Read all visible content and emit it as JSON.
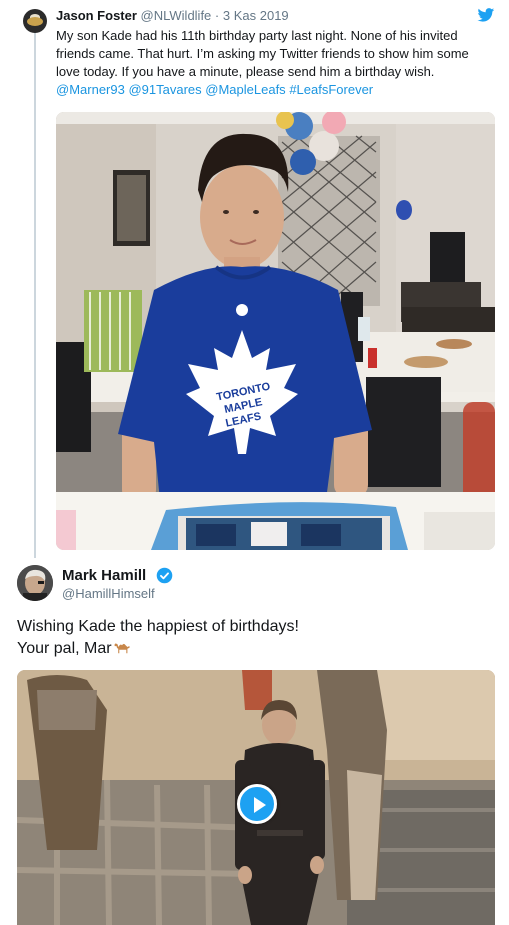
{
  "quoted_tweet": {
    "author_name": "Jason Foster",
    "author_handle": "@NLWildlife",
    "separator": "·",
    "date": "3 Kas 2019",
    "text_plain": "My son Kade had his 11th birthday party last night. None of his invited friends came. That hurt. I’m asking my Twitter friends to show him some love today. If you have a minute, please send him a birthday wish. ",
    "mentions": [
      "@Marner93",
      "@91Tavares",
      "@MapleLeafs",
      "#LeafsForever"
    ],
    "photo": {
      "shirt_text_line1": "TORONTO",
      "shirt_text_line2": "MAPLE",
      "shirt_text_line3": "LEAFS",
      "brand_color": "#1a3d9c"
    },
    "link_color": "#1b95e0",
    "icon": "twitter-bird-icon"
  },
  "reply_tweet": {
    "author_name": "Mark Hamill",
    "author_handle": "@HamillHimself",
    "verified_icon": "verified-badge-icon",
    "line1": "Wishing Kade the happiest of birthdays!",
    "line2": "Your pal, Mar",
    "emoji_icon": "camel-icon",
    "video_play_icon": "play-icon",
    "accent_color": "#1da1f2"
  }
}
